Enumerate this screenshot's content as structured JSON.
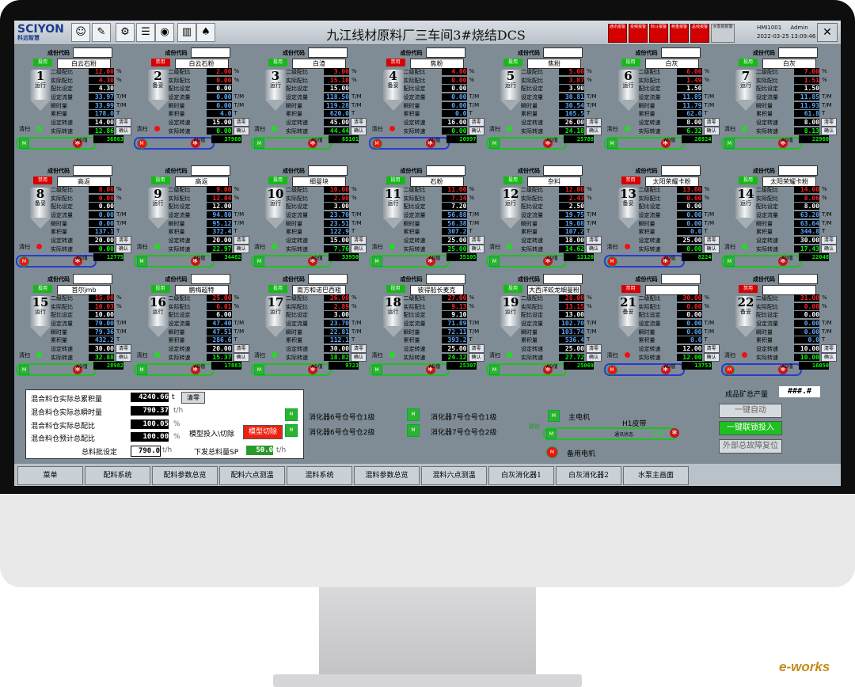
{
  "app": {
    "title": "九江线材原料厂三车间3#烧结DCS",
    "logo": "SCIYON",
    "logo_sub": "科远智慧",
    "hmi_id": "HMI1001",
    "user": "Admin",
    "datetime": "2022-03-25 13:09:46"
  },
  "alarms": [
    "通讯报警",
    "变频报警",
    "料斗报警",
    "称重报警",
    "总线报警",
    "水泵房报警"
  ],
  "labels": {
    "code": "成份代码",
    "erji": "二级配比",
    "shiji": "实际配比",
    "peibi": "配比设定",
    "liuliang": "设定流量",
    "shunshi": "瞬时量",
    "leiji": "累积量",
    "zhuansu": "设定转速",
    "shijizs": "实际转速",
    "clean": "清扫",
    "zero": "清零",
    "ok": "确认",
    "ad": "AD值",
    "M": "M"
  },
  "units_row1": [
    {
      "no": "1",
      "st": "运行",
      "mode": "投用",
      "mat": "白云石粉",
      "erji": "12.00",
      "shiji": "4.30",
      "peibi": "4.30",
      "liuliang": "33.97",
      "shunshi": "33.99",
      "leiji": "178.0",
      "zs": "14.00",
      "sjzs": "12.86",
      "ad": "36863"
    },
    {
      "no": "2",
      "st": "备妥",
      "mode": "禁用",
      "mat": "白云石粉",
      "erji": "2.00",
      "shiji": "0.00",
      "peibi": "0.00",
      "liuliang": "0.00",
      "shunshi": "0.00",
      "leiji": "4.0",
      "zs": "15.00",
      "sjzs": "0.00",
      "ad": "37968"
    },
    {
      "no": "3",
      "st": "运行",
      "mode": "投用",
      "mat": "白渣",
      "erji": "3.00",
      "shiji": "15.10",
      "peibi": "15.00",
      "liuliang": "118.50",
      "shunshi": "119.28",
      "leiji": "620.0",
      "zs": "45.00",
      "sjzs": "44.44",
      "ad": "65101"
    },
    {
      "no": "4",
      "st": "备妥",
      "mode": "禁用",
      "mat": "焦粉",
      "erji": "4.00",
      "shiji": "0.00",
      "peibi": "0.00",
      "liuliang": "0.00",
      "shunshi": "0.00",
      "leiji": "0.0",
      "zs": "16.00",
      "sjzs": "0.00",
      "ad": "20997"
    },
    {
      "no": "5",
      "st": "运行",
      "mode": "投用",
      "mat": "焦粉",
      "erji": "5.00",
      "shiji": "3.87",
      "peibi": "3.90",
      "liuliang": "30.81",
      "shunshi": "30.54",
      "leiji": "165.5",
      "zs": "26.00",
      "sjzs": "24.18",
      "ad": "25788"
    },
    {
      "no": "6",
      "st": "运行",
      "mode": "投用",
      "mat": "白灰",
      "erji": "6.00",
      "shiji": "1.49",
      "peibi": "1.50",
      "liuliang": "11.85",
      "shunshi": "11.79",
      "leiji": "62.0",
      "zs": "8.00",
      "sjzs": "6.32",
      "ad": "26924"
    },
    {
      "no": "7",
      "st": "运行",
      "mode": "投用",
      "mat": "白灰",
      "erji": "7.00",
      "shiji": "1.51",
      "peibi": "1.50",
      "liuliang": "11.85",
      "shunshi": "11.93",
      "leiji": "61.8",
      "zs": "8.00",
      "sjzs": "8.13",
      "ad": "22960"
    }
  ],
  "units_row2": [
    {
      "no": "8",
      "st": "备妥",
      "mode": "禁用",
      "mat": "高返",
      "erji": "8.00",
      "shiji": "0.00",
      "peibi": "0.00",
      "liuliang": "0.00",
      "shunshi": "0.00",
      "leiji": "137.1",
      "zs": "20.00",
      "sjzs": "0.00",
      "ad": "12775"
    },
    {
      "no": "9",
      "st": "运行",
      "mode": "投用",
      "mat": "高返",
      "erji": "9.00",
      "shiji": "12.04",
      "peibi": "12.00",
      "liuliang": "94.80",
      "shunshi": "95.12",
      "leiji": "372.4",
      "zs": "20.00",
      "sjzs": "22.97",
      "ad": "34482"
    },
    {
      "no": "10",
      "st": "运行",
      "mode": "投用",
      "mat": "细曼块",
      "erji": "10.00",
      "shiji": "2.98",
      "peibi": "3.00",
      "liuliang": "23.70",
      "shunshi": "23.51",
      "leiji": "122.9",
      "zs": "15.00",
      "sjzs": "7.76",
      "ad": "33950"
    },
    {
      "no": "11",
      "st": "运行",
      "mode": "投用",
      "mat": "石粉",
      "erji": "11.00",
      "shiji": "7.14",
      "peibi": "7.20",
      "liuliang": "56.88",
      "shunshi": "56.38",
      "leiji": "307.2",
      "zs": "25.00",
      "sjzs": "25.00",
      "ad": "35105"
    },
    {
      "no": "12",
      "st": "运行",
      "mode": "投用",
      "mat": "杂料",
      "erji": "12.00",
      "shiji": "2.43",
      "peibi": "2.50",
      "liuliang": "19.75",
      "shunshi": "19.08",
      "leiji": "107.2",
      "zs": "18.00",
      "sjzs": "14.62",
      "ad": "12120"
    },
    {
      "no": "13",
      "st": "备妥",
      "mode": "禁用",
      "mat": "太阳荣耀卡粉",
      "erji": "13.00",
      "shiji": "0.00",
      "peibi": "0.00",
      "liuliang": "0.00",
      "shunshi": "0.00",
      "leiji": "0.0",
      "zs": "25.00",
      "sjzs": "0.00",
      "ad": "8224"
    },
    {
      "no": "14",
      "st": "运行",
      "mode": "投用",
      "mat": "太阳荣耀卡粉",
      "erji": "14.00",
      "shiji": "8.06",
      "peibi": "8.00",
      "liuliang": "63.20",
      "shunshi": "63.64",
      "leiji": "344.8",
      "zs": "30.00",
      "sjzs": "17.43",
      "ad": "22048"
    }
  ],
  "units_row3": [
    {
      "no": "15",
      "st": "运行",
      "mode": "投用",
      "mat": "首尔jmb",
      "erji": "15.00",
      "shiji": "10.03",
      "peibi": "10.00",
      "liuliang": "79.00",
      "shunshi": "79.36",
      "leiji": "432.2",
      "zs": "30.00",
      "sjzs": "32.88",
      "ad": "28982"
    },
    {
      "no": "16",
      "st": "运行",
      "mode": "投用",
      "mat": "鹏梅超特",
      "erji": "25.00",
      "shiji": "6.01",
      "peibi": "6.00",
      "liuliang": "47.40",
      "shunshi": "47.51",
      "leiji": "286.6",
      "zs": "20.00",
      "sjzs": "15.37",
      "ad": "17883"
    },
    {
      "no": "17",
      "st": "运行",
      "mode": "投用",
      "mat": "南方和诺巴西粗",
      "erji": "26.00",
      "shiji": "2.89",
      "peibi": "3.00",
      "liuliang": "23.70",
      "shunshi": "22.81",
      "leiji": "112.1",
      "zs": "30.00",
      "sjzs": "18.82",
      "ad": "9723"
    },
    {
      "no": "18",
      "st": "运行",
      "mode": "投用",
      "mat": "彼得船长麦克",
      "erji": "27.00",
      "shiji": "9.13",
      "peibi": "9.10",
      "liuliang": "71.89",
      "shunshi": "72.11",
      "leiji": "393.2",
      "zs": "25.00",
      "sjzs": "24.12",
      "ad": "25307"
    },
    {
      "no": "19",
      "st": "运行",
      "mode": "投用",
      "mat": "大西洋蛟龙细曼粉",
      "erji": "28.00",
      "shiji": "13.15",
      "peibi": "13.00",
      "liuliang": "102.70",
      "shunshi": "103.74",
      "leiji": "536.4",
      "zs": "25.00",
      "sjzs": "27.72",
      "ad": "25069"
    },
    {
      "no": "21",
      "st": "备妥",
      "mode": "禁用",
      "mat": "",
      "erji": "30.00",
      "shiji": "0.00",
      "peibi": "0.00",
      "liuliang": "0.00",
      "shunshi": "0.00",
      "leiji": "0.0",
      "zs": "12.00",
      "sjzs": "12.00",
      "ad": "13753"
    },
    {
      "no": "22",
      "st": "备妥",
      "mode": "禁用",
      "mat": "",
      "erji": "31.00",
      "shiji": "0.00",
      "peibi": "0.00",
      "liuliang": "0.00",
      "shunshi": "0.00",
      "leiji": "0.0",
      "zs": "10.00",
      "sjzs": "10.00",
      "ad": "16050"
    }
  ],
  "summary": {
    "total_acc_label": "混合料仓实际总累积量",
    "total_acc": "4240.66",
    "total_acc_unit": "t",
    "clear": "清零",
    "total_inst_label": "混合料仓实际总瞬时量",
    "total_inst": "790.37",
    "total_inst_unit": "t/h",
    "actual_ratio_label": "混合料仓实际总配比",
    "actual_ratio": "100.05",
    "pct": "%",
    "plan_ratio_label": "混合料仓预计总配比",
    "plan_ratio": "100.00",
    "mode_label": "模型投入\\切除",
    "mode_btn": "模型切除",
    "batch_label": "总料批设定",
    "batch": "790.0",
    "batch_unit": "t/h",
    "sp_label": "下发总料量SP",
    "sp": "50.0",
    "sp_unit": "t/h"
  },
  "digesters": {
    "d6_1": "消化器6号仓号仓1级",
    "d6_2": "消化器6号仓号仓2级",
    "d7_1": "消化器7号仓号仓1级",
    "d7_2": "消化器7号仓号仓2级"
  },
  "belt": {
    "main_motor": "主电机",
    "belt_name": "H1皮带",
    "link": "联锁",
    "comm": "通讯状态",
    "run": "正常",
    "standby": "备用电机"
  },
  "right": {
    "product_label": "成品矿总产量",
    "product_value": "###.#",
    "auto": "一键自动",
    "interlock": "一键联锁投入",
    "reset": "外部总故障复位"
  },
  "nav": [
    "菜单",
    "配料系统",
    "配料参数总览",
    "配料六点测温",
    "混料系统",
    "混料参数总览",
    "混料六点测温",
    "白灰消化器1",
    "白灰消化器2",
    "水泵主画面"
  ],
  "watermark": "e-works"
}
